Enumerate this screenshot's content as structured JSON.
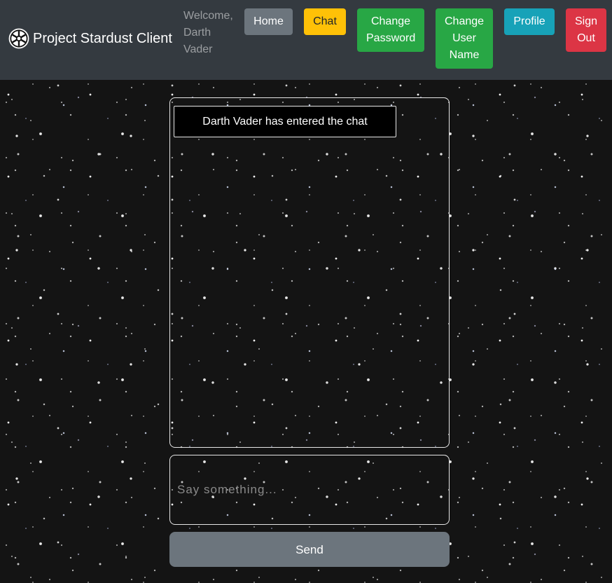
{
  "navbar": {
    "brand_label": "Project Stardust Client",
    "brand_icon": "imperial-emblem-icon",
    "welcome_prefix": "Welcome,",
    "user_first_name": "Darth",
    "user_last_name": "Vader",
    "buttons": {
      "home": "Home",
      "chat": "Chat",
      "change_password": [
        "Change",
        "Password"
      ],
      "change_username": [
        "Change",
        "User",
        "Name"
      ],
      "profile": "Profile",
      "sign_out": [
        "Sign",
        "Out"
      ]
    },
    "colors": {
      "navbar_bg": "#343a40",
      "home": "#6c757d",
      "chat": "#ffc107",
      "change_password": "#28a745",
      "change_username": "#28a745",
      "profile": "#17a2b8",
      "sign_out": "#dc3545"
    }
  },
  "chat": {
    "messages": [
      {
        "text": "Darth Vader has entered the chat"
      }
    ],
    "input_placeholder": "Say something...",
    "input_value": "",
    "send_label": "Send",
    "colors": {
      "send_bg": "#6c757d",
      "message_bg": "#000000",
      "border": "#e6e6e6"
    }
  }
}
